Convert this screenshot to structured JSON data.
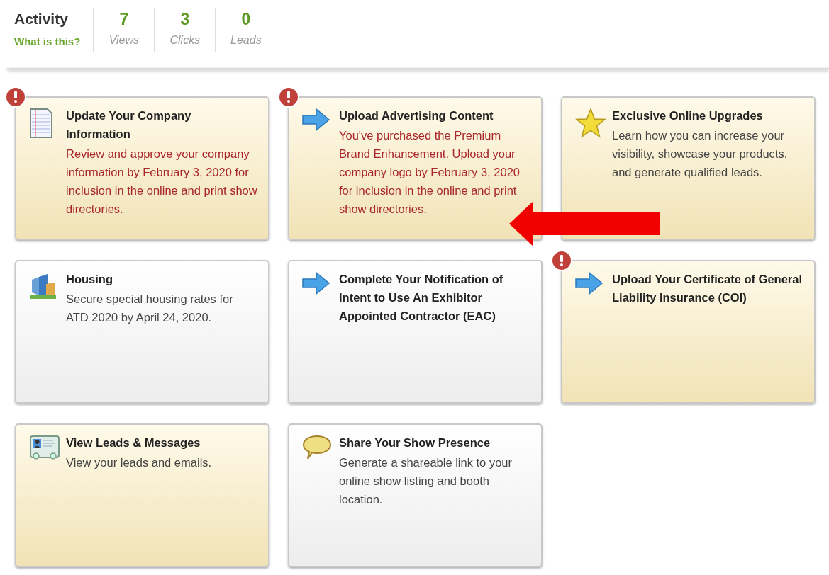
{
  "activity": {
    "title": "Activity",
    "help_link": "What is this?",
    "stats": [
      {
        "value": "7",
        "label": "Views"
      },
      {
        "value": "3",
        "label": "Clicks"
      },
      {
        "value": "0",
        "label": "Leads"
      }
    ]
  },
  "cards": [
    {
      "kind": "document",
      "alert": true,
      "highlighted": true,
      "title": "Update Your Company Information",
      "text": "Review and approve your company information by February 3, 2020 for inclusion in the online and print show directories."
    },
    {
      "kind": "arrow",
      "alert": true,
      "highlighted": true,
      "title": "Upload Advertising Content",
      "text": "You've purchased the Premium Brand Enhancement. Upload your company logo by February 3, 2020 for inclusion in the online and print show directories."
    },
    {
      "kind": "star",
      "alert": false,
      "highlighted": true,
      "title": "Exclusive Online Upgrades",
      "text": "Learn how you can increase your visibility, showcase your products, and generate qualified leads."
    },
    {
      "kind": "buildings",
      "alert": false,
      "highlighted": false,
      "title": "Housing",
      "text": "Secure special housing rates for ATD 2020 by April 24, 2020."
    },
    {
      "kind": "arrow",
      "alert": false,
      "highlighted": false,
      "title": "Complete Your Notification of Intent to Use An Exhibitor Appointed Contractor (EAC)"
    },
    {
      "kind": "arrow",
      "alert": true,
      "highlighted": true,
      "title": "Upload Your Certificate of General Liability Insurance (COI)"
    },
    {
      "kind": "card",
      "alert": false,
      "highlighted": true,
      "title": "View Leads & Messages",
      "text": "View your leads and emails."
    },
    {
      "kind": "bubble",
      "alert": false,
      "highlighted": false,
      "title": "Share Your Show Presence",
      "text": "Generate a shareable link to your online show listing and booth location."
    }
  ]
}
